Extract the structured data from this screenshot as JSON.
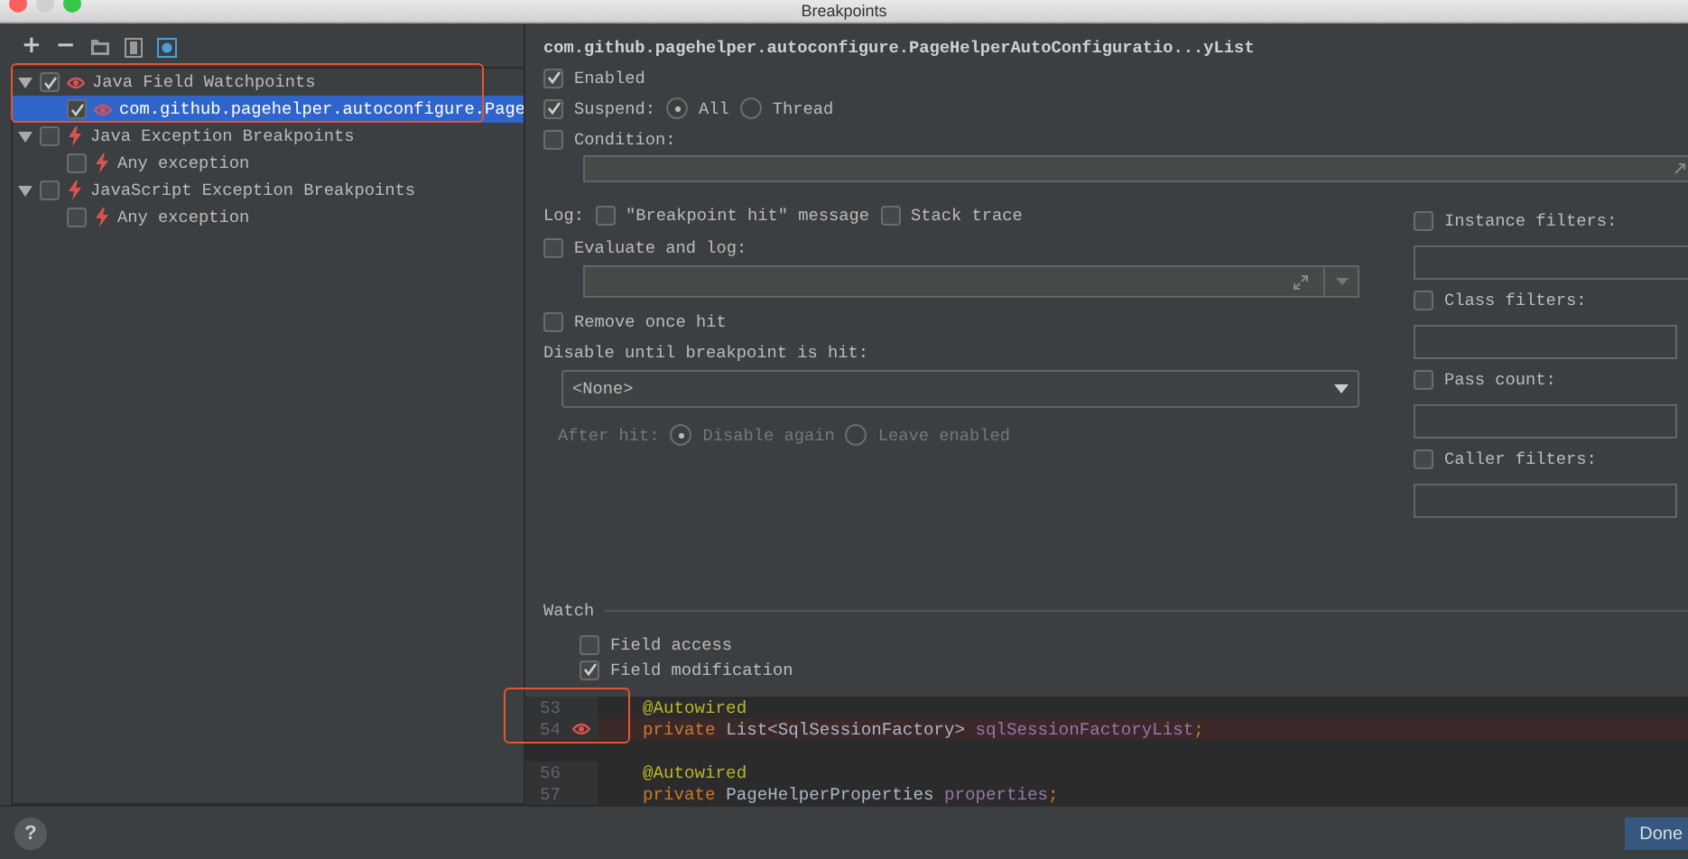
{
  "window": {
    "title": "Breakpoints"
  },
  "toolbar": {
    "add": "+",
    "remove": "−"
  },
  "tree": [
    {
      "label": "Java Field Watchpoints",
      "kind": "watch",
      "checked": true,
      "expanded": true,
      "selected": false,
      "children": [
        {
          "label": "com.github.pagehelper.autoconfigure.Page",
          "kind": "watch",
          "checked": true,
          "selected": true
        }
      ]
    },
    {
      "label": "Java Exception Breakpoints",
      "kind": "exception",
      "checked": false,
      "expanded": true,
      "selected": false,
      "children": [
        {
          "label": "Any exception",
          "kind": "exception",
          "checked": false,
          "selected": false
        }
      ]
    },
    {
      "label": "JavaScript Exception Breakpoints",
      "kind": "exception",
      "checked": false,
      "expanded": true,
      "selected": false,
      "children": [
        {
          "label": "Any exception",
          "kind": "exception",
          "checked": false,
          "selected": false
        }
      ]
    }
  ],
  "details": {
    "heading": "com.github.pagehelper.autoconfigure.PageHelperAutoConfiguratio...yList",
    "enabled": {
      "label": "Enabled",
      "checked": true
    },
    "suspend": {
      "label": "Suspend:",
      "checked": true,
      "options": [
        {
          "label": "All",
          "selected": true
        },
        {
          "label": "Thread",
          "selected": false
        }
      ]
    },
    "condition": {
      "label": "Condition:",
      "checked": false
    },
    "log": {
      "label": "Log:",
      "options": [
        {
          "label": "\"Breakpoint hit\" message",
          "checked": false
        },
        {
          "label": "Stack trace",
          "checked": false
        }
      ]
    },
    "evaluate": {
      "label": "Evaluate and log:",
      "checked": false
    },
    "remove_once_hit": {
      "label": "Remove once hit",
      "checked": false
    },
    "disable_until": {
      "label": "Disable until breakpoint is hit:",
      "value": "<None>"
    },
    "after_hit": {
      "label": "After hit:",
      "disabled": true,
      "options": [
        {
          "label": "Disable again",
          "selected": true
        },
        {
          "label": "Leave enabled",
          "selected": false
        }
      ]
    },
    "filters": [
      {
        "label": "Instance filters:",
        "checked": false
      },
      {
        "label": "Class filters:",
        "checked": false
      },
      {
        "label": "Pass count:",
        "checked": false
      },
      {
        "label": "Caller filters:",
        "checked": false
      }
    ],
    "watch": {
      "title": "Watch",
      "options": [
        {
          "label": "Field access",
          "checked": false
        },
        {
          "label": "Field modification",
          "checked": true
        }
      ]
    },
    "code": [
      {
        "number": "53",
        "breakpoint": false,
        "highlighted": false,
        "tokens": [
          {
            "text": "@Autowired",
            "kind": "annotation"
          }
        ]
      },
      {
        "number": "54",
        "breakpoint": true,
        "highlighted": true,
        "tokens": [
          {
            "text": "private ",
            "kind": "keyword"
          },
          {
            "text": "List<SqlSessionFactory> ",
            "kind": "plain"
          },
          {
            "text": "sqlSessionFactoryList",
            "kind": "field"
          },
          {
            "text": ";",
            "kind": "keyword"
          }
        ]
      },
      {
        "number": "56",
        "breakpoint": false,
        "highlighted": false,
        "gap_before": true,
        "tokens": [
          {
            "text": "@Autowired",
            "kind": "annotation"
          }
        ]
      },
      {
        "number": "57",
        "breakpoint": false,
        "highlighted": false,
        "tokens": [
          {
            "text": "private ",
            "kind": "keyword"
          },
          {
            "text": "PageHelperProperties ",
            "kind": "plain"
          },
          {
            "text": "properties",
            "kind": "field"
          },
          {
            "text": ";",
            "kind": "keyword"
          }
        ]
      }
    ]
  },
  "footer": {
    "help": "?",
    "done": "Done"
  }
}
